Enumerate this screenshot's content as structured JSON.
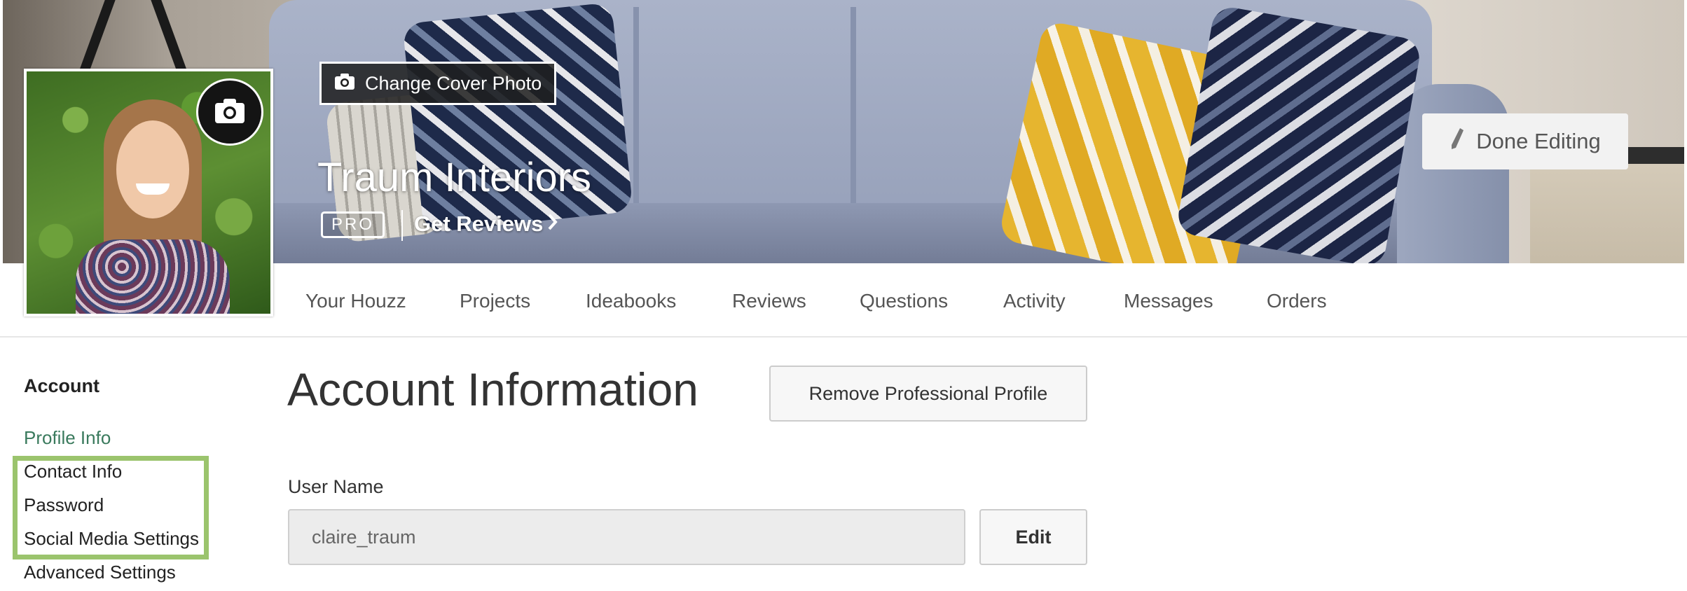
{
  "cover": {
    "change_cover_label": "Change Cover Photo",
    "camera_icon": "camera-icon",
    "business_name": "Traum Interiors",
    "pro_badge": "PRO",
    "get_reviews_label": "Get Reviews",
    "get_reviews_icon": "chevron-right-icon",
    "done_editing_label": "Done Editing",
    "done_editing_icon": "pencil-icon"
  },
  "avatar": {
    "camera_icon": "camera-icon"
  },
  "nav": {
    "tabs": [
      {
        "label": "Your Houzz"
      },
      {
        "label": "Projects"
      },
      {
        "label": "Ideabooks"
      },
      {
        "label": "Reviews"
      },
      {
        "label": "Questions"
      },
      {
        "label": "Activity"
      },
      {
        "label": "Messages"
      },
      {
        "label": "Orders"
      }
    ]
  },
  "sidebar": {
    "heading": "Account",
    "items": [
      {
        "label": "Profile Info",
        "active": true
      },
      {
        "label": "Contact Info"
      },
      {
        "label": "Password"
      },
      {
        "label": "Social Media Settings"
      },
      {
        "label": "Advanced Settings"
      }
    ]
  },
  "main": {
    "title": "Account Information",
    "remove_profile_label": "Remove Professional Profile",
    "username_label": "User Name",
    "username_value": "claire_traum",
    "edit_label": "Edit"
  },
  "colors": {
    "active_link": "#3a7a5d",
    "highlight_border": "#9bc46d",
    "button_bg": "#f7f7f7",
    "input_bg": "#ececec"
  }
}
